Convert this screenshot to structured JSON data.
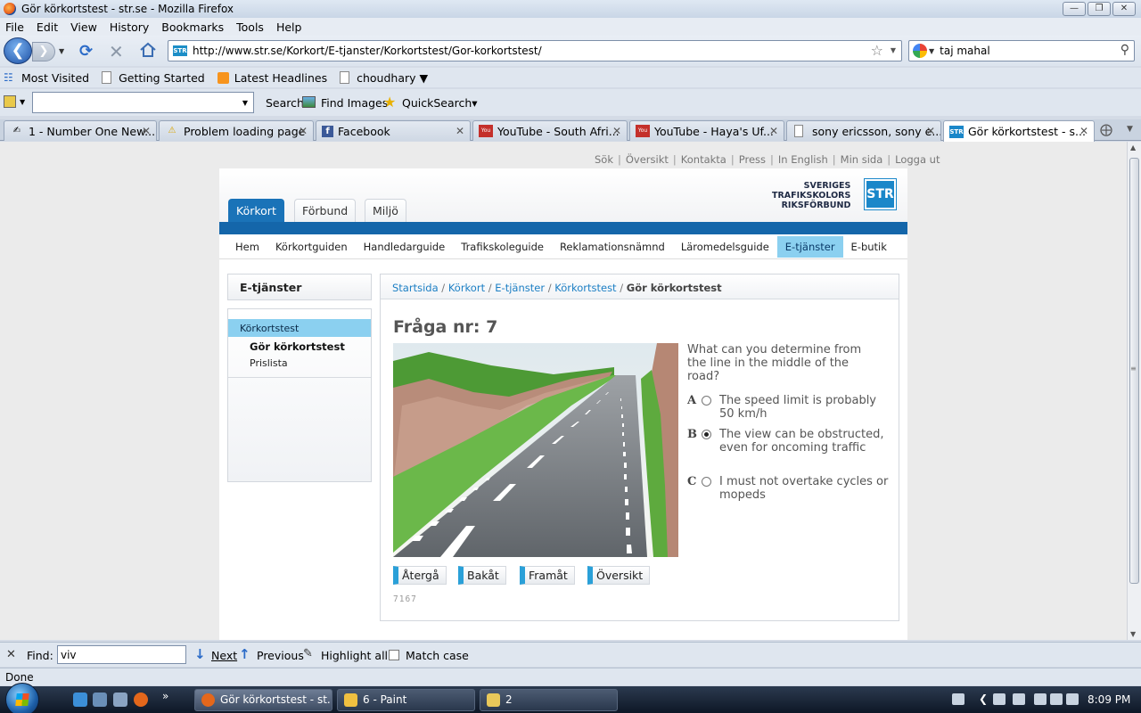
{
  "window": {
    "title": "Gör körkortstest - str.se - Mozilla Firefox"
  },
  "menu": [
    "File",
    "Edit",
    "View",
    "History",
    "Bookmarks",
    "Tools",
    "Help"
  ],
  "nav": {
    "url": "http://www.str.se/Korkort/E-tjanster/Korkortstest/Gor-korkortstest/",
    "site_icon": "STR",
    "search_value": "taj mahal"
  },
  "bookmarks": [
    "Most Visited",
    "Getting Started",
    "Latest Headlines",
    "choudhary ▼"
  ],
  "toolbar2": {
    "search_label": "Search",
    "find_images_label": "Find Images",
    "quicksearch_label": "QuickSearch▾"
  },
  "tabs": [
    {
      "label": "1 - Number One New...",
      "icon": "handshake-icon"
    },
    {
      "label": "Problem loading page",
      "icon": "warning-icon"
    },
    {
      "label": "Facebook",
      "icon": "facebook-icon"
    },
    {
      "label": "YouTube - South Afri...",
      "icon": "youtube-icon"
    },
    {
      "label": "YouTube - Haya's Uf...",
      "icon": "youtube-icon"
    },
    {
      "label": "sony ericsson, sony e...",
      "icon": "page-icon"
    },
    {
      "label": "Gör körkortstest - s...",
      "icon": "str-icon"
    }
  ],
  "site": {
    "topnav": [
      "Sök",
      "Översikt",
      "Kontakta",
      "Press",
      "In English",
      "Min sida",
      "Logga ut"
    ],
    "logo_lines": [
      "SVERIGES",
      "TRAFIKSKOLORS",
      "RIKSFÖRBUND"
    ],
    "logo_box": "STR",
    "main_tabs": [
      "Körkort",
      "Förbund",
      "Miljö"
    ],
    "subnav": [
      "Hem",
      "Körkortguiden",
      "Handledarguide",
      "Trafikskoleguide",
      "Reklamationsnämnd",
      "Läromedelsguide",
      "E-tjänster",
      "E-butik"
    ],
    "sidebar": {
      "heading": "E-tjänster",
      "active_item": "Körkortstest",
      "sub_items": [
        "Gör körkortstest",
        "Prislista"
      ]
    },
    "breadcrumb": [
      "Startsida",
      "Körkort",
      "E-tjänster",
      "Körkortstest",
      "Gör körkortstest"
    ],
    "question": {
      "title": "Fråga nr: 7",
      "text": "What can you determine from the line in the middle of the road?",
      "options": [
        {
          "letter": "A",
          "text": "The speed limit is probably 50 km/h",
          "selected": false
        },
        {
          "letter": "B",
          "text": "The view can be obstructed, even for oncoming traffic",
          "selected": true
        },
        {
          "letter": "C",
          "text": "I must not overtake cycles or mopeds",
          "selected": false
        }
      ],
      "buttons": [
        "Återgå",
        "Bakåt",
        "Framåt",
        "Översikt"
      ],
      "id": "7167"
    }
  },
  "findbar": {
    "label": "Find:",
    "value": "viv",
    "next": "Next",
    "previous": "Previous",
    "highlight": "Highlight all",
    "match_case": "Match case"
  },
  "status": "Done",
  "taskbar": {
    "tasks": [
      "Gör körkortstest - st...",
      "6 - Paint",
      "2"
    ],
    "clock": "8:09 PM"
  }
}
